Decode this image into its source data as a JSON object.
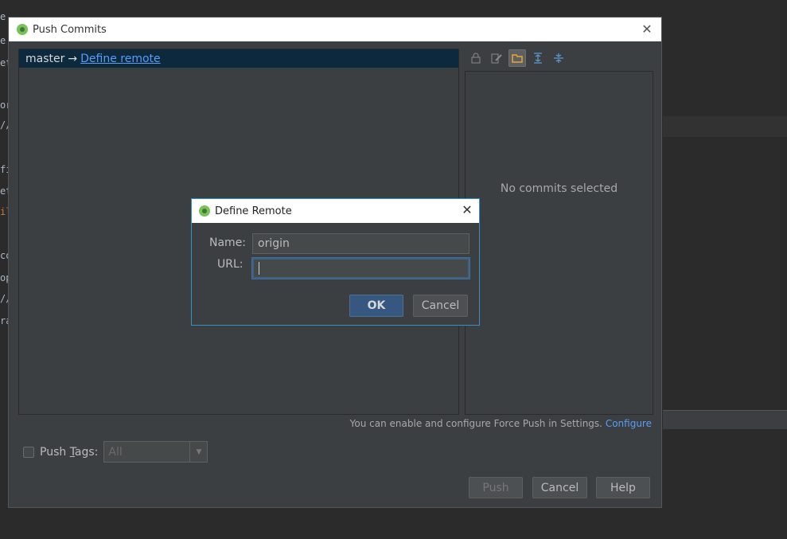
{
  "background": {
    "code_fragments": [
      "e.",
      "e",
      "et",
      "or",
      "//",
      "fi",
      "et",
      "il",
      "co",
      "op",
      "//",
      "ra"
    ]
  },
  "dialog": {
    "title": "Push Commits",
    "branch": {
      "local": "master",
      "arrow": "→",
      "remote_link": "Define remote"
    },
    "toolbar_icons": [
      "lock-icon",
      "edit-icon",
      "folder-icon",
      "expand-all-icon",
      "collapse-all-icon"
    ],
    "empty_message": "No commits selected",
    "force_push_note": "You can enable and configure Force Push in Settings.",
    "configure_link": "Configure",
    "push_tags": {
      "label_prefix": "Push ",
      "label_underlined": "T",
      "label_suffix": "ags:",
      "checked": false,
      "value": "All"
    },
    "buttons": {
      "push": "Push",
      "cancel": "Cancel",
      "help": "Help"
    }
  },
  "modal": {
    "title": "Define Remote",
    "name_label": "Name:",
    "name_value": "origin",
    "url_label": "URL:",
    "url_value": "",
    "ok": "OK",
    "cancel": "Cancel"
  }
}
